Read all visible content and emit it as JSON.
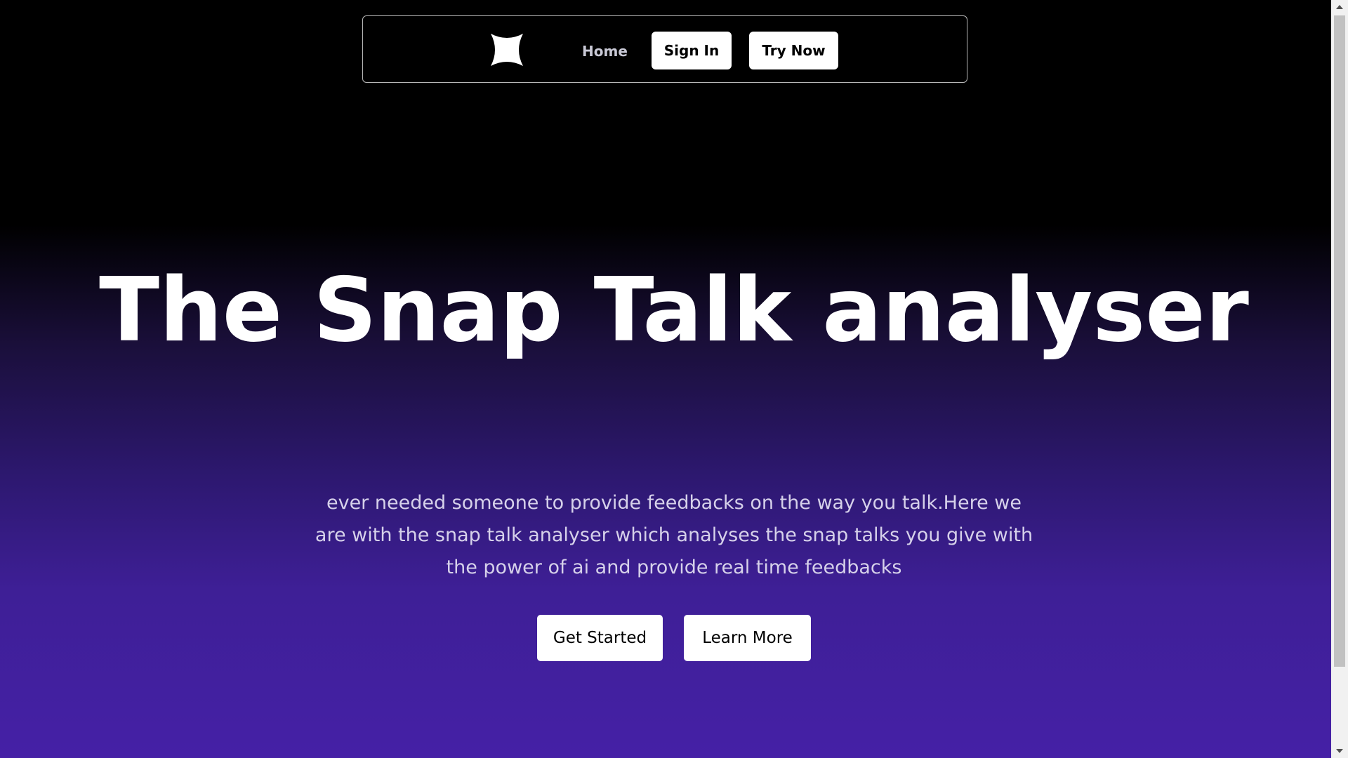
{
  "navbar": {
    "logo_icon": "four-point-star-icon",
    "home_label": "Home",
    "signin_label": "Sign In",
    "trynow_label": "Try Now"
  },
  "hero": {
    "title": "The Snap Talk analyser",
    "subtitle": "ever needed someone to provide feedbacks on the way you talk.Here we are with the snap talk analyser which analyses the snap talks you give with the power of ai and provide real time feedbacks",
    "get_started_label": "Get Started",
    "learn_more_label": "Learn More"
  },
  "colors": {
    "background_top": "#000000",
    "background_bottom": "#4520a6",
    "button_bg": "#ffffff",
    "button_text": "#000000",
    "nav_link_text": "#c9c9d6",
    "subtitle_text": "#d6d1ea"
  },
  "scrollbar": {
    "up_icon": "scroll-up-arrow-icon",
    "down_icon": "scroll-down-arrow-icon"
  }
}
